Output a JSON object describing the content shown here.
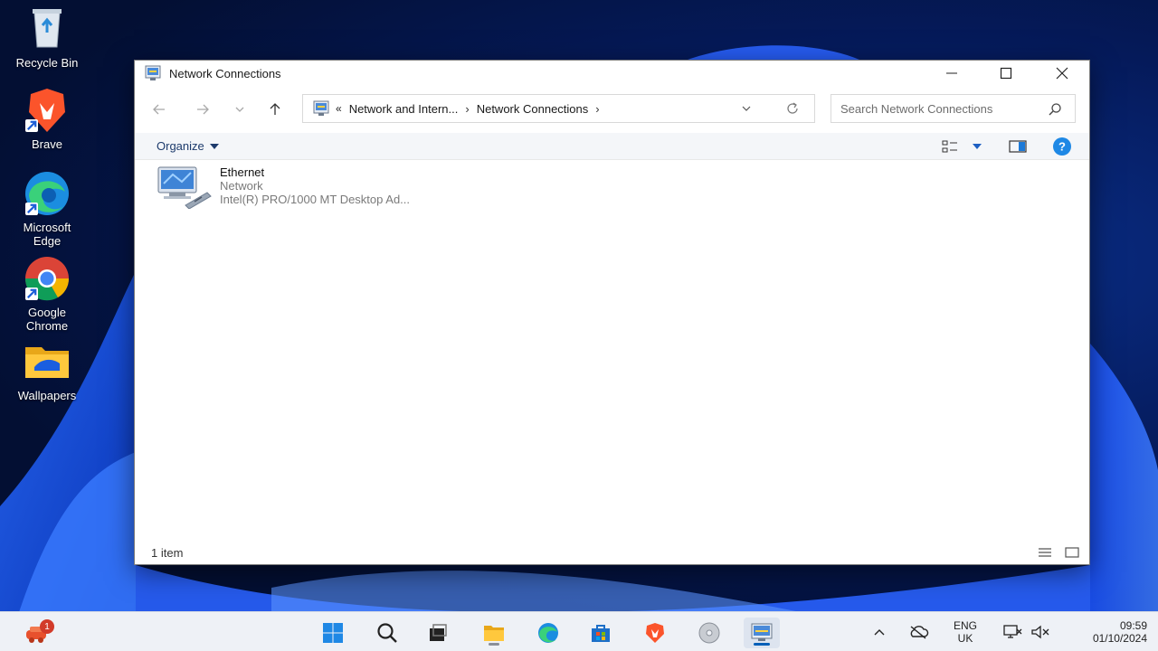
{
  "desktop": {
    "icons": [
      {
        "label": "Recycle Bin",
        "icon": "recycle-bin-icon"
      },
      {
        "label": "Brave",
        "icon": "brave-icon"
      },
      {
        "label": "Microsoft Edge",
        "icon": "edge-icon"
      },
      {
        "label": "Google Chrome",
        "icon": "chrome-icon"
      },
      {
        "label": "Wallpapers",
        "icon": "folder-icon"
      }
    ]
  },
  "window": {
    "title": "Network Connections",
    "breadcrumb": {
      "overflow": "«",
      "items": [
        "Network and Intern...",
        "Network Connections"
      ]
    },
    "search_placeholder": "Search Network Connections",
    "organize_label": "Organize",
    "items": [
      {
        "name": "Ethernet",
        "status": "Network",
        "device": "Intel(R) PRO/1000 MT Desktop Ad..."
      }
    ],
    "status_count": "1 item"
  },
  "taskbar": {
    "notification_badge": "1",
    "apps": [
      "start",
      "search",
      "task-view",
      "file-explorer",
      "edge",
      "store",
      "brave",
      "disc",
      "network-connections"
    ],
    "language": {
      "line1": "ENG",
      "line2": "UK"
    },
    "clock": {
      "time": "09:59",
      "date": "01/10/2024"
    }
  },
  "colors": {
    "accent": "#005fb8",
    "help": "#1e88e5"
  }
}
